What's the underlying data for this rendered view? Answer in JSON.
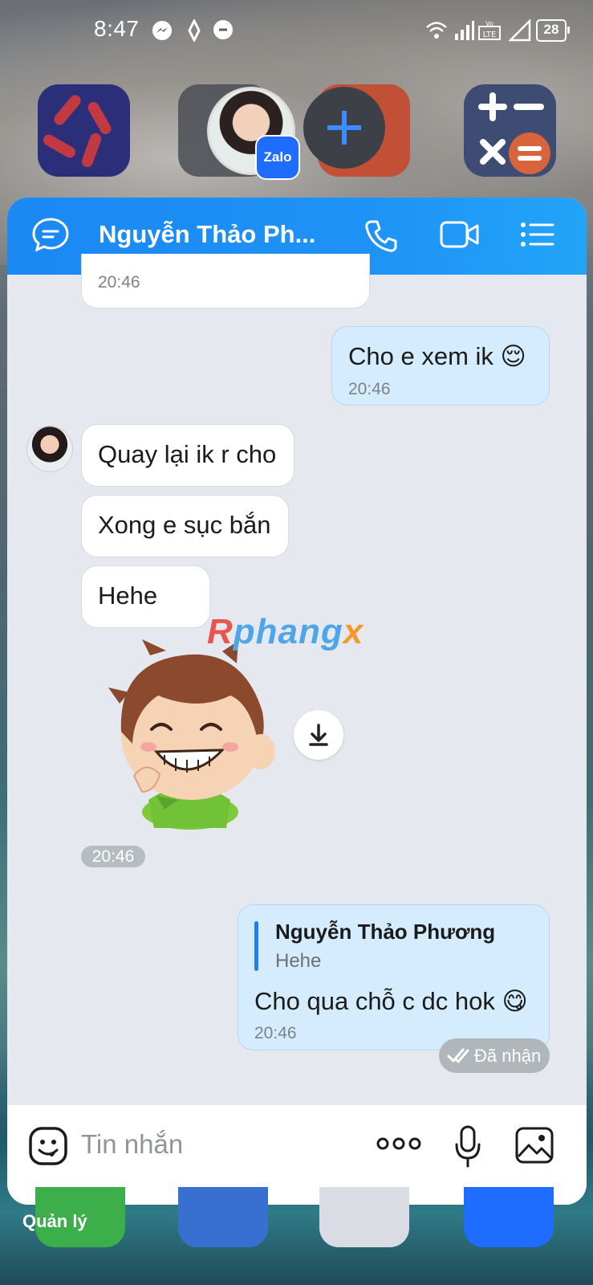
{
  "status_bar": {
    "time": "8:47",
    "battery": "28",
    "icons": [
      "messenger-icon",
      "vpn-icon",
      "chat-icon",
      "wifi-icon",
      "signal-icon",
      "volte-lte-icon",
      "signal-empty-icon",
      "battery-icon"
    ]
  },
  "chat": {
    "title": "Nguyễn Thảo Ph...",
    "header_icons": [
      "chat-bubble-icon",
      "phone-icon",
      "video-icon",
      "list-icon"
    ],
    "messages": [
      {
        "direction": "in",
        "time": "20:46"
      },
      {
        "direction": "out",
        "text": "Cho e xem ik 😌",
        "time": "20:46"
      },
      {
        "direction": "in",
        "text": "Quay lại ik r cho"
      },
      {
        "direction": "in",
        "text": "Xong e sục bắn"
      },
      {
        "direction": "in",
        "text": "Hehe"
      },
      {
        "direction": "in",
        "type": "sticker",
        "time": "20:46"
      },
      {
        "direction": "out",
        "reply_to_name": "Nguyễn Thảo Phương",
        "reply_to_text": "Hehe",
        "text": "Cho qua chỗ c dc hok 😋",
        "time": "20:46"
      }
    ],
    "status": "Đã nhận",
    "input_placeholder": "Tin nhắn",
    "input_icons": [
      "emoji-icon",
      "more-icon",
      "microphone-icon",
      "image-icon"
    ]
  },
  "watermark": {
    "part1": "R",
    "part2": "phang",
    "part3": "x"
  },
  "dock": {
    "label": "Quản lý"
  }
}
